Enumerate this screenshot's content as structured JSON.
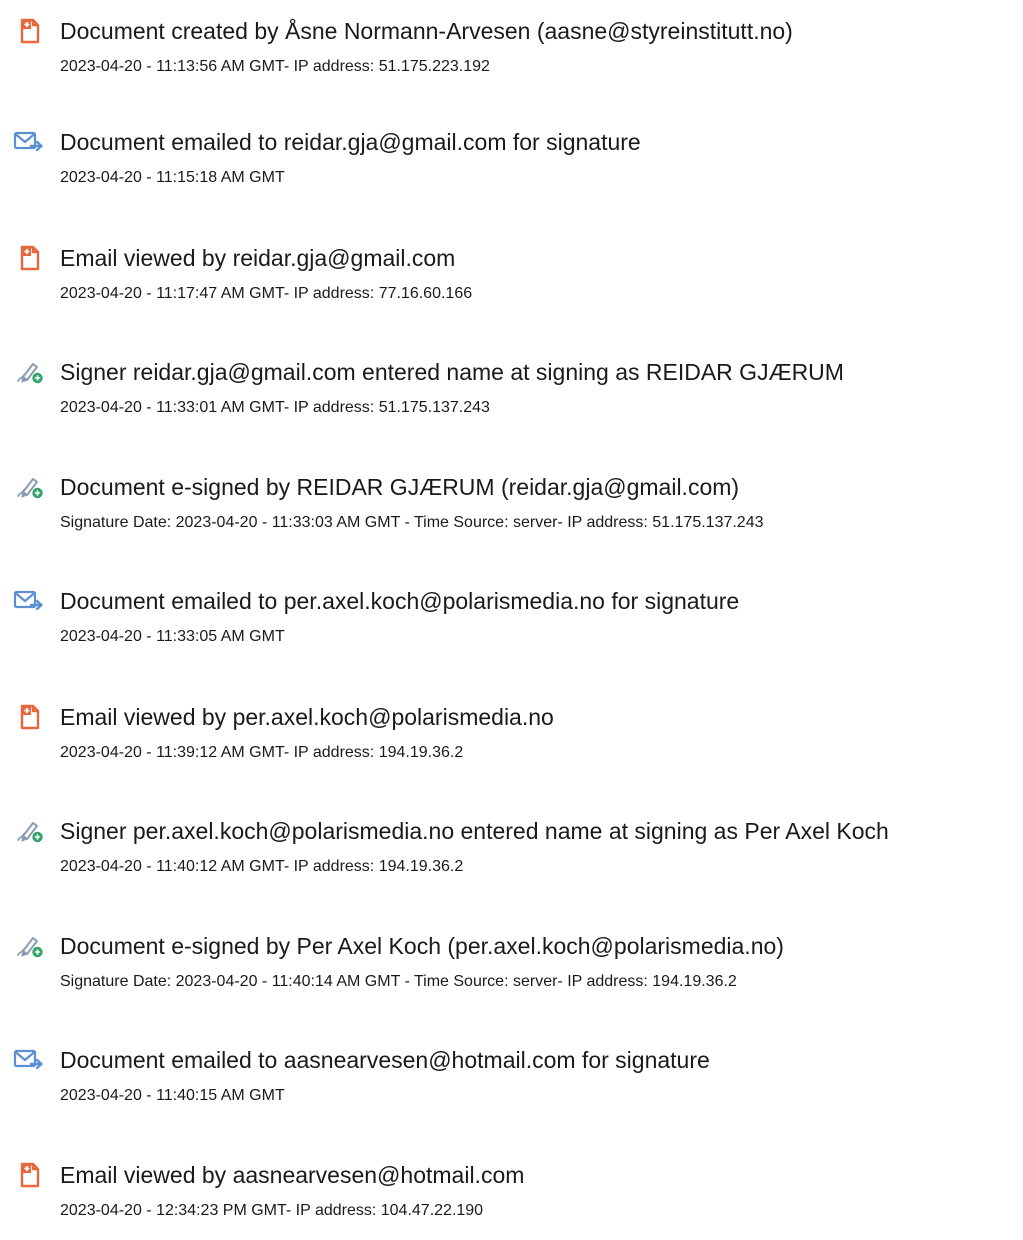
{
  "colors": {
    "doc_icon": "#e8673c",
    "email_icon": "#5b8fd0",
    "sign_pen": "#8a9bb0",
    "sign_badge": "#35a36b",
    "text": "#1a1a1a"
  },
  "events": [
    {
      "icon": "document-icon",
      "title": "Document created by Åsne Normann-Arvesen (aasne@styreinstitutt.no)",
      "detail": "2023-04-20 - 11:13:56 AM GMT- IP address: 51.175.223.192"
    },
    {
      "icon": "email-sent-icon",
      "title": "Document emailed to reidar.gja@gmail.com for signature",
      "detail": "2023-04-20 - 11:15:18 AM GMT"
    },
    {
      "icon": "document-icon",
      "title": "Email viewed by reidar.gja@gmail.com",
      "detail": "2023-04-20 - 11:17:47 AM GMT- IP address: 77.16.60.166"
    },
    {
      "icon": "signature-pen-icon",
      "title": "Signer reidar.gja@gmail.com entered name at signing as REIDAR GJÆRUM",
      "detail": "2023-04-20 - 11:33:01 AM GMT- IP address: 51.175.137.243"
    },
    {
      "icon": "signature-pen-icon",
      "title": "Document e-signed by REIDAR GJÆRUM (reidar.gja@gmail.com)",
      "detail": "Signature Date: 2023-04-20 - 11:33:03 AM GMT - Time Source: server- IP address: 51.175.137.243"
    },
    {
      "icon": "email-sent-icon",
      "title": "Document emailed to per.axel.koch@polarismedia.no for signature",
      "detail": "2023-04-20 - 11:33:05 AM GMT"
    },
    {
      "icon": "document-icon",
      "title": "Email viewed by per.axel.koch@polarismedia.no",
      "detail": "2023-04-20 - 11:39:12 AM GMT- IP address: 194.19.36.2"
    },
    {
      "icon": "signature-pen-icon",
      "title": "Signer per.axel.koch@polarismedia.no entered name at signing as Per Axel Koch",
      "detail": "2023-04-20 - 11:40:12 AM GMT- IP address: 194.19.36.2"
    },
    {
      "icon": "signature-pen-icon",
      "title": "Document e-signed by Per Axel Koch (per.axel.koch@polarismedia.no)",
      "detail": "Signature Date: 2023-04-20 - 11:40:14 AM GMT - Time Source: server- IP address: 194.19.36.2"
    },
    {
      "icon": "email-sent-icon",
      "title": "Document emailed to aasnearvesen@hotmail.com for signature",
      "detail": "2023-04-20 - 11:40:15 AM GMT"
    },
    {
      "icon": "document-icon",
      "title": "Email viewed by aasnearvesen@hotmail.com",
      "detail": "2023-04-20 - 12:34:23 PM GMT- IP address: 104.47.22.190"
    }
  ]
}
